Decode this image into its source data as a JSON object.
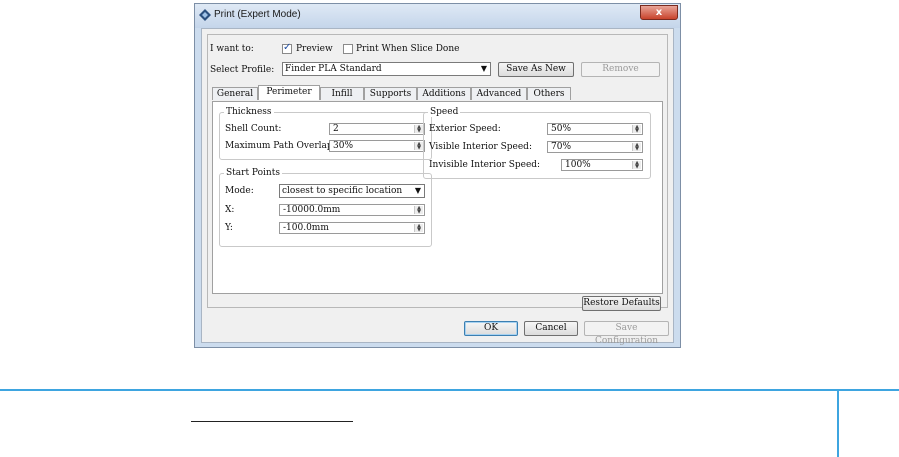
{
  "window": {
    "title": "Print (Expert Mode)",
    "close_glyph": "x"
  },
  "options": {
    "i_want_to_label": "I want to:",
    "preview_label": "Preview",
    "preview_checked": true,
    "print_when_done_label": "Print When Slice Done",
    "print_when_done_checked": false,
    "select_profile_label": "Select Profile:",
    "profile_value": "Finder PLA Standard",
    "save_as_new_label": "Save As New",
    "remove_label": "Remove"
  },
  "tabs": [
    {
      "label": "General"
    },
    {
      "label": "Perimeter",
      "active": true
    },
    {
      "label": "Infill"
    },
    {
      "label": "Supports"
    },
    {
      "label": "Additions"
    },
    {
      "label": "Advanced"
    },
    {
      "label": "Others"
    }
  ],
  "thickness": {
    "title": "Thickness",
    "shell_count_label": "Shell Count:",
    "shell_count_value": "2",
    "max_overlap_label": "Maximum Path Overlap:",
    "max_overlap_value": "30%"
  },
  "start_points": {
    "title": "Start Points",
    "mode_label": "Mode:",
    "mode_value": "closest to specific location",
    "x_label": "X:",
    "x_value": "-10000.0mm",
    "y_label": "Y:",
    "y_value": "-100.0mm"
  },
  "speed": {
    "title": "Speed",
    "exterior_label": "Exterior Speed:",
    "exterior_value": "50%",
    "visible_interior_label": "Visible Interior Speed:",
    "visible_interior_value": "70%",
    "invisible_interior_label": "Invisible Interior Speed:",
    "invisible_interior_value": "100%"
  },
  "buttons": {
    "restore_defaults": "Restore Defaults",
    "ok": "OK",
    "cancel": "Cancel",
    "save_configuration": "Save Configuration"
  },
  "colors": {
    "accent_line": "#3ea5e0",
    "window_frame": "#ccdcee"
  }
}
